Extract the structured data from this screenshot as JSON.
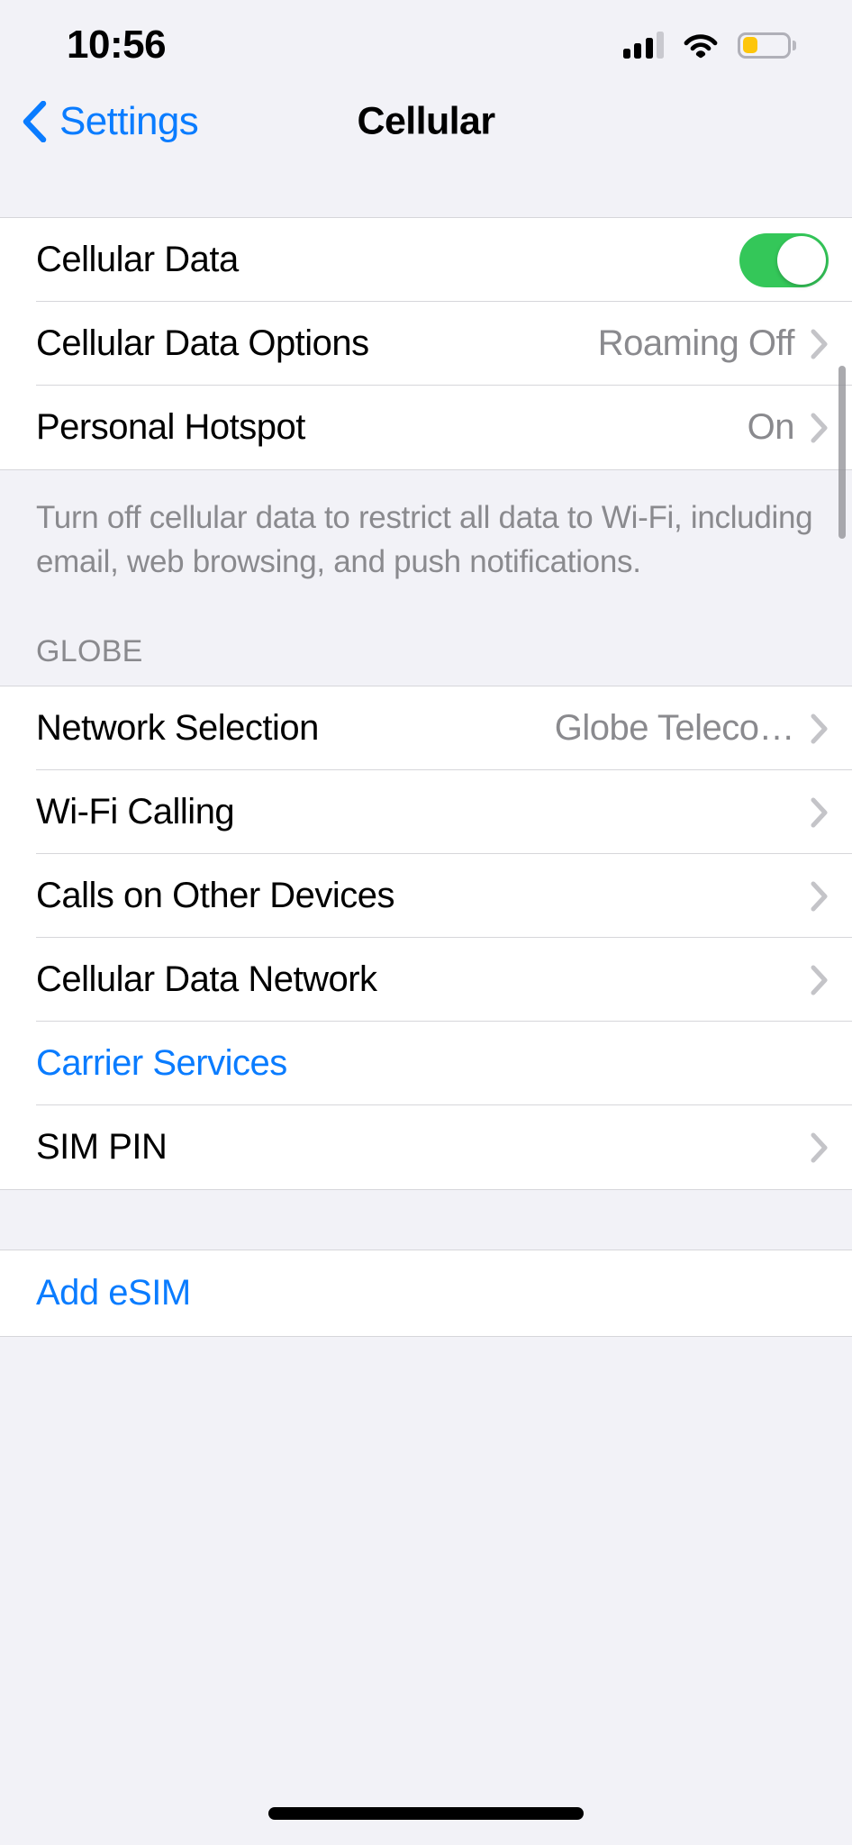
{
  "status_bar": {
    "time": "10:56",
    "signal_icon": "cellular-signal-icon",
    "signal_bars_total": 4,
    "signal_bars_filled": 3,
    "wifi_icon": "wifi-icon",
    "battery_icon": "battery-icon",
    "battery_percent": 35,
    "battery_color": "#fdc60b"
  },
  "nav": {
    "back_label": "Settings",
    "back_icon": "chevron-left-icon",
    "title": "Cellular"
  },
  "colors": {
    "accent_blue": "#0a7cff",
    "toggle_green": "#34c759",
    "secondary_text": "#8a8a8e",
    "background": "#f2f2f7",
    "row_background": "#ffffff"
  },
  "section_data": {
    "rows": [
      {
        "label": "Cellular Data",
        "type": "toggle",
        "value": "on"
      },
      {
        "label": "Cellular Data Options",
        "type": "disclosure",
        "value": "Roaming Off"
      },
      {
        "label": "Personal Hotspot",
        "type": "disclosure",
        "value": "On"
      }
    ],
    "footer": "Turn off cellular data to restrict all data to Wi-Fi, including email, web browsing, and push notifications."
  },
  "section_carrier": {
    "header": "GLOBE",
    "rows": [
      {
        "label": "Network Selection",
        "type": "disclosure",
        "value": "Globe Teleco…"
      },
      {
        "label": "Wi-Fi Calling",
        "type": "disclosure",
        "value": ""
      },
      {
        "label": "Calls on Other Devices",
        "type": "disclosure",
        "value": ""
      },
      {
        "label": "Cellular Data Network",
        "type": "disclosure",
        "value": ""
      },
      {
        "label": "Carrier Services",
        "type": "link",
        "value": ""
      },
      {
        "label": "SIM PIN",
        "type": "disclosure",
        "value": ""
      }
    ]
  },
  "section_esim": {
    "rows": [
      {
        "label": "Add eSIM",
        "type": "link",
        "value": ""
      }
    ]
  }
}
